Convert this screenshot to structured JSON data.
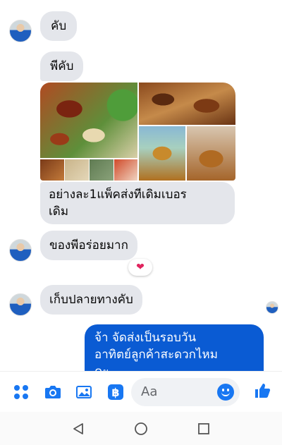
{
  "messages": [
    {
      "text": "คับ"
    },
    {
      "text": "พีคับ"
    },
    {
      "text_line1": "อย่างละ1แพ็คส่งทีเดิมเบอร",
      "text_line2": "เดิม"
    },
    {
      "text": "ของพีอร่อยมาก",
      "reaction": "heart"
    },
    {
      "text": "เก็บปลายทางคับ"
    },
    {
      "text_line1": "จ้า  จัดส่งเป็นรอบวัน",
      "text_line2": "อาทิตย์ลูกค้าสะดวกไหม",
      "text_line3": "คะ"
    }
  ],
  "composer": {
    "placeholder": "Aa",
    "icons": [
      "menu-dots-icon",
      "camera-icon",
      "gallery-icon",
      "baht-payment-icon",
      "emoji-icon",
      "thumbs-up-icon"
    ]
  },
  "colors": {
    "accent": "#1877f2",
    "incoming_bubble": "#e4e6eb",
    "outgoing_bubble": "#0a5bd3"
  },
  "navbar": {
    "icons": [
      "back-icon",
      "home-icon",
      "recents-icon"
    ]
  }
}
